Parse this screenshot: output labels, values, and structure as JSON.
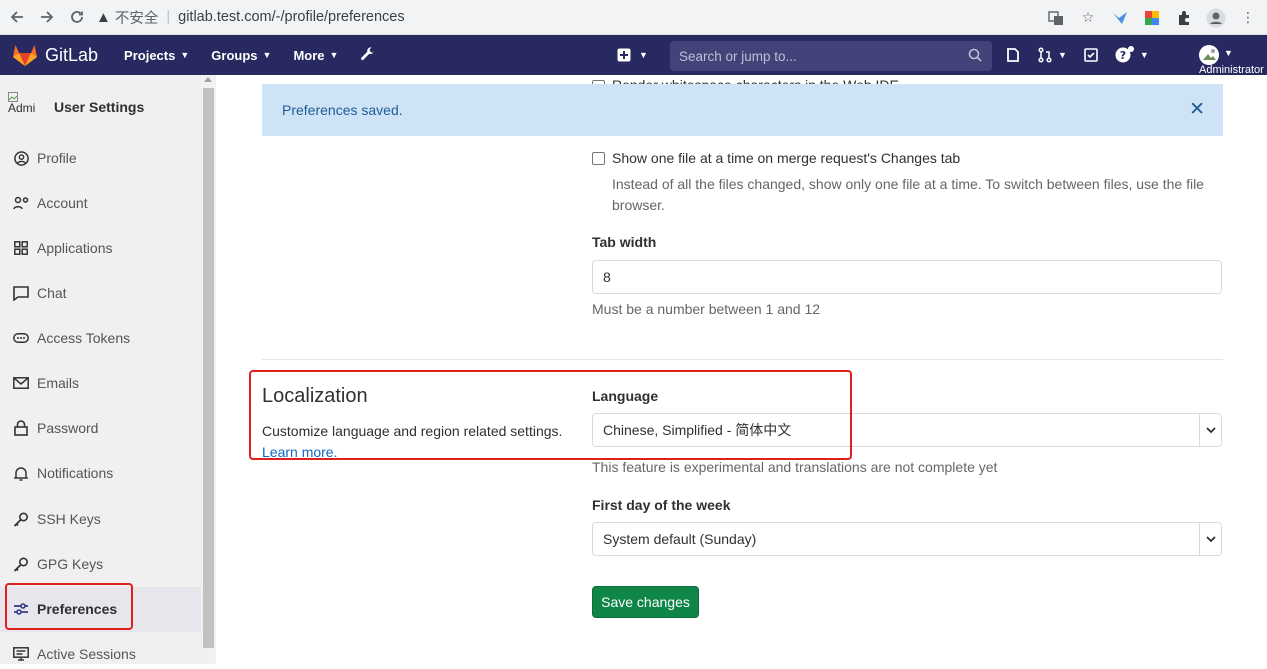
{
  "browser": {
    "security_label": "不安全",
    "url": "gitlab.test.com/-/profile/preferences"
  },
  "navbar": {
    "brand": "GitLab",
    "menu": [
      {
        "label": "Projects"
      },
      {
        "label": "Groups"
      },
      {
        "label": "More"
      }
    ],
    "search_placeholder": "Search or jump to...",
    "user_name": "Administrator"
  },
  "sidebar": {
    "avatar_alt": "Admi",
    "title": "User Settings",
    "items": [
      {
        "label": "Profile",
        "icon": "profile-icon"
      },
      {
        "label": "Account",
        "icon": "account-icon"
      },
      {
        "label": "Applications",
        "icon": "applications-icon"
      },
      {
        "label": "Chat",
        "icon": "chat-icon"
      },
      {
        "label": "Access Tokens",
        "icon": "token-icon"
      },
      {
        "label": "Emails",
        "icon": "mail-icon"
      },
      {
        "label": "Password",
        "icon": "lock-icon"
      },
      {
        "label": "Notifications",
        "icon": "bell-icon"
      },
      {
        "label": "SSH Keys",
        "icon": "key-icon"
      },
      {
        "label": "GPG Keys",
        "icon": "key-icon"
      },
      {
        "label": "Preferences",
        "icon": "preferences-icon",
        "active": true
      },
      {
        "label": "Active Sessions",
        "icon": "monitor-icon"
      }
    ]
  },
  "main": {
    "partial_text": "Render whitespace characters in the Web IDE",
    "alert": "Preferences saved.",
    "show_one_file_label": "Show one file at a time on merge request's Changes tab",
    "show_one_file_help_1": "Instead of all the files changed, show only one file at a time. To switch between files, use the file",
    "show_one_file_help_2": "browser.",
    "tab_width_label": "Tab width",
    "tab_width_value": "8",
    "tab_width_help": "Must be a number between 1 and 12",
    "localization_title": "Localization",
    "localization_desc": "Customize language and region related settings.",
    "learn_more": "Learn more.",
    "language_label": "Language",
    "language_value": "Chinese, Simplified - 简体中文",
    "language_help": "This feature is experimental and translations are not complete yet",
    "first_day_label": "First day of the week",
    "first_day_value": "System default (Sunday)",
    "save_button": "Save changes"
  },
  "colors": {
    "navbar": "#292961",
    "alert_bg": "#cee4f6",
    "save_button": "#108548",
    "annotation": "#e0201a"
  }
}
